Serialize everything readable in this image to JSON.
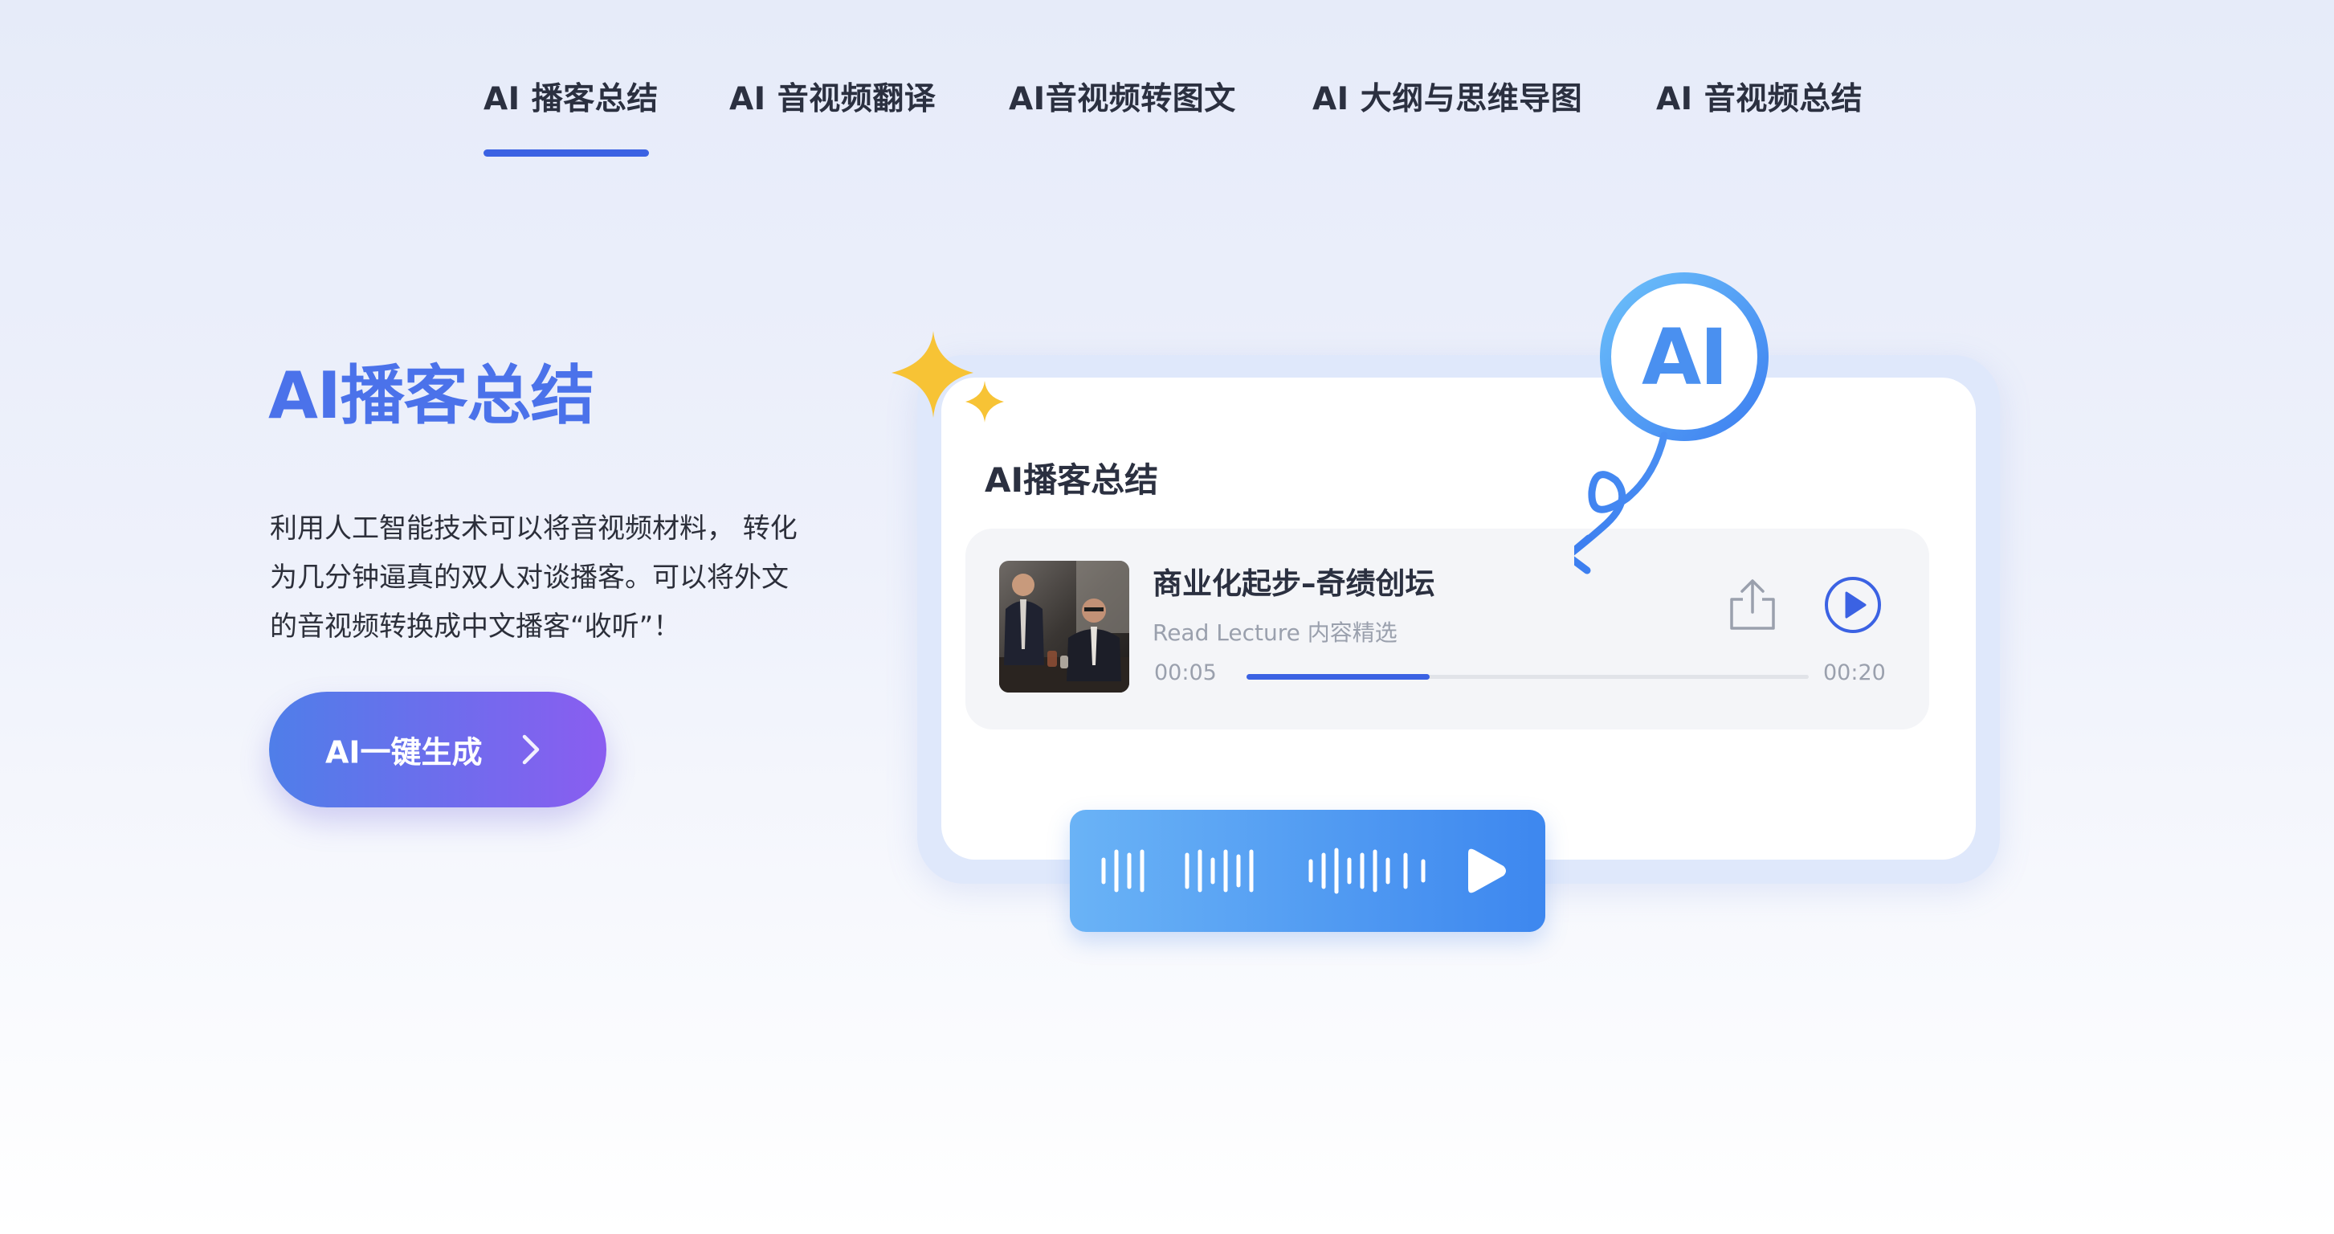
{
  "tabs": [
    {
      "label": "AI 播客总结",
      "active": true
    },
    {
      "label": "AI 音视频翻译"
    },
    {
      "label": "AI音视频转图文"
    },
    {
      "label": "AI 大纲与思维导图"
    },
    {
      "label": "AI 音视频总结"
    }
  ],
  "hero": {
    "title": "AI播客总结",
    "description": "利用人工智能技术可以将音视频材料， 转化为几分钟逼真的双人对谈播客。可以将外文的音视频转换成中文播客“收听”！",
    "cta_label": "AI一键生成"
  },
  "card": {
    "title": "AI播客总结",
    "badge_text": "AI",
    "player": {
      "episode_title": "商业化起步–奇绩创坛",
      "source": "Read Lecture 内容精选",
      "current_time": "00:05",
      "duration": "00:20",
      "progress": 0.325
    }
  },
  "icons": {
    "share": "share-icon",
    "play": "play-circle-icon",
    "cta_arrow": "chevron-right-icon",
    "wave_play": "play-icon",
    "sparkle": "sparkle-icon"
  },
  "colors": {
    "accent": "#3b62e3",
    "title_blue": "#4b72ea",
    "cta_start": "#4f7ee9",
    "cta_end": "#8a5df0",
    "wave_start": "#6ab3f6",
    "wave_end": "#3d87ef",
    "sparkle": "#f7c335"
  }
}
